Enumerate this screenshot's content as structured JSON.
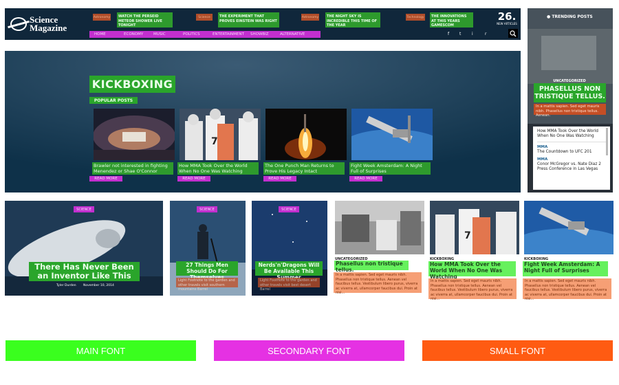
{
  "header": {
    "logo_line1": "Science",
    "logo_line2": "Magazine",
    "ticker": [
      {
        "category": "Astronomy",
        "text": "WATCH THE PERSEID METEOR SHOWER LIVE TONIGHT"
      },
      {
        "category": "Science",
        "text": "THE EXPERIMENT THAT PROVES EINSTEIN WAS RIGHT"
      },
      {
        "category": "Astronomy",
        "text": "THE NIGHT SKY IS INCREDIBLE THIS TIME OF THE YEAR"
      },
      {
        "category": "Technology",
        "text": "THE INNOVATIONS AT THIS YEARS GAMESCOM"
      }
    ],
    "date_number": "26.",
    "date_caption": "NEW ARTICLES",
    "nav": [
      "HOME",
      "ECONOMY",
      "MUSIC",
      "POLITICS",
      "ENTERTAINMENT",
      "SHOWBIZ",
      "ALTERNATIVE"
    ],
    "social": [
      "f",
      "t",
      "i",
      "r"
    ],
    "search_icon": "search-icon"
  },
  "hero": {
    "title": "KICKBOXING",
    "popular_label": "POPULAR POSTS",
    "read_more": "READ MORE",
    "posts": [
      {
        "caption": "Brawler not interested in fighting Menendez or Shae O'Connor"
      },
      {
        "caption": "How MMA Took Over the World When No One Was Watching"
      },
      {
        "caption": "The One Punch Man Returns to Prove His Legacy Intact"
      },
      {
        "caption": "Fight Week Amsterdam: A Night Full of Surprises"
      }
    ]
  },
  "trending": {
    "label": "TRENDING POSTS",
    "category": "UNCATEGORIZED",
    "title": "PHASELLUS NON TRISTIQUE TELLUS.",
    "excerpt": "In a mattis sapien. Sed eget mauris nibh. Phasellus non tristique tellus. Aenean.",
    "list": [
      {
        "category": "",
        "title": "How MMA Took Over the World When No One Was Watching"
      },
      {
        "category": "MMA",
        "title": "The Countdown to UFC 201"
      },
      {
        "category": "MMA",
        "title": "Conor McGregor vs. Nate Diaz 2 Press Conference in Las Vegas"
      }
    ]
  },
  "cards": [
    {
      "category": "SCIENCE",
      "title": "There Has Never Been an Inventor Like This",
      "author": "Tyler Durden",
      "date": "November 10, 2014"
    },
    {
      "category": "SCIENCE",
      "title": "27 Things Men Should Do For Themselves",
      "excerpt": "Light Footnote to the garden and other travels visit southern mountains Barrel"
    },
    {
      "category": "SCIENCE",
      "title": "Nerds'n'Dragons Will Be Available This Summer",
      "excerpt": "Light Footnote to the garden and other travels visit best desert Barrel"
    }
  ],
  "bottom_posts": [
    {
      "category": "UNCATEGORIZED",
      "title": "Phasellus non tristique tellus.",
      "excerpt": "In a mattis sapien. Sed eget mauris nibh. Phasellus non tristique tellus. Aenean vel faucibus tellus. Vestibulum libero purus, viverra ac viverra at, ullamcorper faucibus dui. Proin at nisi..."
    },
    {
      "category": "KICKBOXING",
      "title": "How MMA Took Over the World When No One Was Watching",
      "excerpt": "In a mattis sapien. Sed eget mauris nibh. Phasellus non tristique tellus. Aenean vel faucibus tellus. Vestibulum libero purus, viverra ac viverra at, ullamcorper faucibus dui. Proin at nisi..."
    },
    {
      "category": "KICKBOXING",
      "title": "Fight Week Amsterdam: A Night Full of Surprises",
      "excerpt": "In a mattis sapien. Sed eget mauris nibh. Phasellus non tristique tellus. Aenean vel faucibus tellus. Vestibulum libero purus, viverra ac viverra at, ullamcorper faucibus dui. Proin at nisi..."
    }
  ],
  "legend": {
    "main": "MAIN FONT",
    "secondary": "SECONDARY FONT",
    "small": "SMALL FONT",
    "colors": {
      "main": "#3aff1e",
      "secondary": "#e531e3",
      "small": "#ff5b12"
    }
  }
}
